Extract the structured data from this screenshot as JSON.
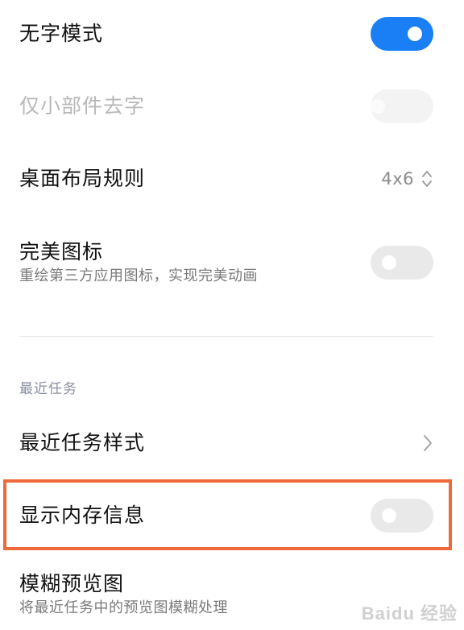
{
  "settings": {
    "no_text_mode": {
      "label": "无字模式",
      "state": "on"
    },
    "widgets_only": {
      "label": "仅小部件去字",
      "state": "disabled"
    },
    "layout_rule": {
      "label": "桌面布局规则",
      "value": "4x6"
    },
    "perfect_icons": {
      "label": "完美图标",
      "subtitle": "重绘第三方应用图标，实现完美动画",
      "state": "off"
    }
  },
  "recent_tasks": {
    "section_header": "最近任务",
    "style": {
      "label": "最近任务样式"
    },
    "memory_info": {
      "label": "显示内存信息",
      "state": "off"
    },
    "blur_preview": {
      "label": "模糊预览图",
      "subtitle": "将最近任务中的预览图模糊处理"
    }
  },
  "watermark": "Baidu 经验",
  "colors": {
    "toggle_on": "#1a7ff5",
    "toggle_off": "#e9e9e9",
    "highlight_border": "#ef6a3a"
  }
}
